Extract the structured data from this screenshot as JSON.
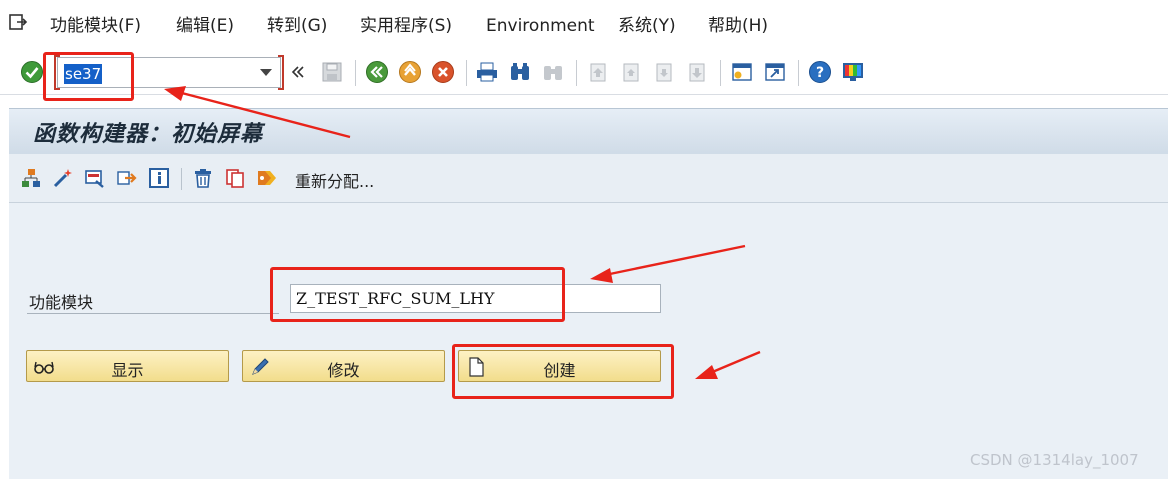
{
  "menu": {
    "items": [
      "功能模块(F)",
      "编辑(E)",
      "转到(G)",
      "实用程序(S)",
      "Environment",
      "系统(Y)",
      "帮助(H)"
    ]
  },
  "toolbar": {
    "command_value": "se37"
  },
  "screen": {
    "title": "函数构建器：初始屏幕",
    "reassign_label": "重新分配..."
  },
  "form": {
    "function_module_label": "功能模块",
    "function_module_value": "Z_TEST_RFC_SUM_LHY"
  },
  "buttons": {
    "display": "显示",
    "change": "修改",
    "create": "创建"
  },
  "watermark": "CSDN @1314lay_1007",
  "colors": {
    "accent_annotation": "#e8231a",
    "button_fill": "#f7e6a6",
    "title_band": "#d6e1ec",
    "selection": "#1460c8"
  }
}
